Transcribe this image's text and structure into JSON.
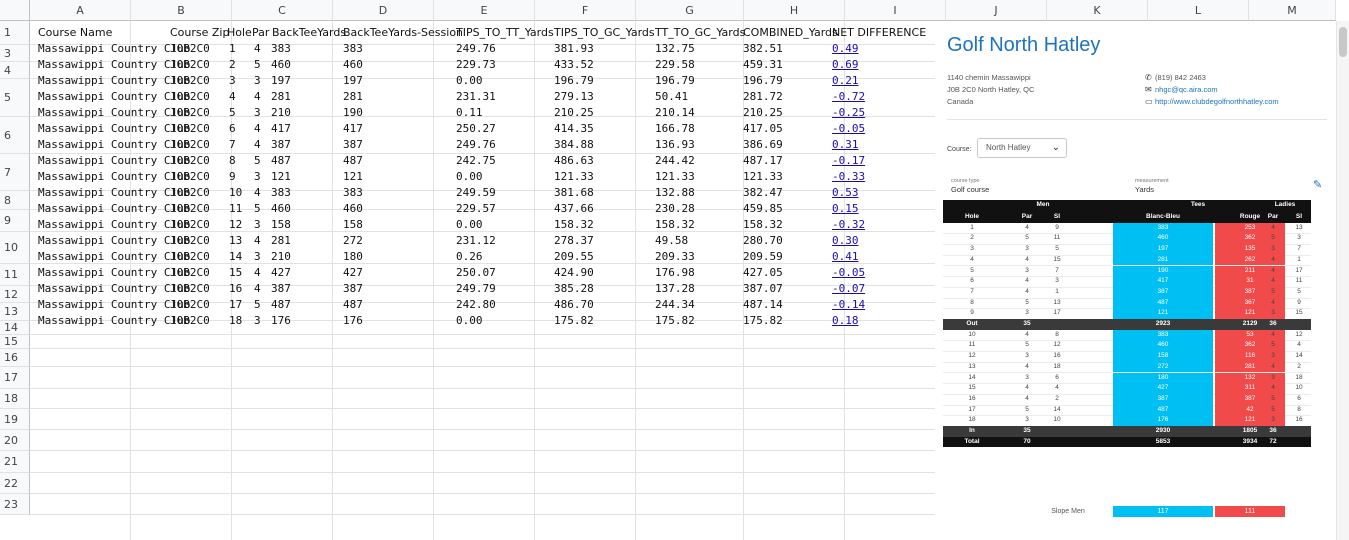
{
  "columns": [
    "A",
    "B",
    "C",
    "D",
    "E",
    "F",
    "G",
    "H",
    "I",
    "J",
    "K",
    "L",
    "M"
  ],
  "row_numbers": [
    "1",
    "3",
    "4",
    "5",
    "6",
    "7",
    "8",
    "9",
    "10",
    "11",
    "12",
    "13",
    "14",
    "15",
    "16",
    "17",
    "18",
    "19",
    "20",
    "21",
    "22",
    "23"
  ],
  "headers": [
    "Course Name",
    "Course Zip",
    "Hole",
    "Par",
    "BackTeeYards",
    "BackTeeYards-Session",
    "TIPS_TO_TT_Yards",
    "TIPS_TO_GC_Yards",
    "TT_TO_GC_Yards",
    "COMBINED_Yards",
    "NET DIFFERENCE"
  ],
  "rows": [
    [
      "Massawippi Country Club",
      "J0B2C0",
      "1",
      "4",
      "383",
      "383",
      "249.76",
      "381.93",
      "132.75",
      "382.51",
      "0.49"
    ],
    [
      "Massawippi Country Club",
      "J0B2C0",
      "2",
      "5",
      "460",
      "460",
      "229.73",
      "433.52",
      "229.58",
      "459.31",
      "0.69"
    ],
    [
      "Massawippi Country Club",
      "J0B2C0",
      "3",
      "3",
      "197",
      "197",
      "0.00",
      "196.79",
      "196.79",
      "196.79",
      "0.21"
    ],
    [
      "Massawippi Country Club",
      "J0B2C0",
      "4",
      "4",
      "281",
      "281",
      "231.31",
      "279.13",
      "50.41",
      "281.72",
      "-0.72"
    ],
    [
      "Massawippi Country Club",
      "J0B2C0",
      "5",
      "3",
      "210",
      "190",
      "0.11",
      "210.25",
      "210.14",
      "210.25",
      "-0.25"
    ],
    [
      "Massawippi Country Club",
      "J0B2C0",
      "6",
      "4",
      "417",
      "417",
      "250.27",
      "414.35",
      "166.78",
      "417.05",
      "-0.05"
    ],
    [
      "Massawippi Country Club",
      "J0B2C0",
      "7",
      "4",
      "387",
      "387",
      "249.76",
      "384.88",
      "136.93",
      "386.69",
      "0.31"
    ],
    [
      "Massawippi Country Club",
      "J0B2C0",
      "8",
      "5",
      "487",
      "487",
      "242.75",
      "486.63",
      "244.42",
      "487.17",
      "-0.17"
    ],
    [
      "Massawippi Country Club",
      "J0B2C0",
      "9",
      "3",
      "121",
      "121",
      "0.00",
      "121.33",
      "121.33",
      "121.33",
      "-0.33"
    ],
    [
      "Massawippi Country Club",
      "J0B2C0",
      "10",
      "4",
      "383",
      "383",
      "249.59",
      "381.68",
      "132.88",
      "382.47",
      "0.53"
    ],
    [
      "Massawippi Country Club",
      "J0B2C0",
      "11",
      "5",
      "460",
      "460",
      "229.57",
      "437.66",
      "230.28",
      "459.85",
      "0.15"
    ],
    [
      "Massawippi Country Club",
      "J0B2C0",
      "12",
      "3",
      "158",
      "158",
      "0.00",
      "158.32",
      "158.32",
      "158.32",
      "-0.32"
    ],
    [
      "Massawippi Country Club",
      "J0B2C0",
      "13",
      "4",
      "281",
      "272",
      "231.12",
      "278.37",
      "49.58",
      "280.70",
      "0.30"
    ],
    [
      "Massawippi Country Club",
      "J0B2C0",
      "14",
      "3",
      "210",
      "180",
      "0.26",
      "209.55",
      "209.33",
      "209.59",
      "0.41"
    ],
    [
      "Massawippi Country Club",
      "J0B2C0",
      "15",
      "4",
      "427",
      "427",
      "250.07",
      "424.90",
      "176.98",
      "427.05",
      "-0.05"
    ],
    [
      "Massawippi Country Club",
      "J0B2C0",
      "16",
      "4",
      "387",
      "387",
      "249.79",
      "385.28",
      "137.28",
      "387.07",
      "-0.07"
    ],
    [
      "Massawippi Country Club",
      "J0B2C0",
      "17",
      "5",
      "487",
      "487",
      "242.80",
      "486.70",
      "244.34",
      "487.14",
      "-0.14"
    ],
    [
      "Massawippi Country Club",
      "J0B2C0",
      "18",
      "3",
      "176",
      "176",
      "0.00",
      "175.82",
      "175.82",
      "175.82",
      "0.18"
    ]
  ],
  "panel": {
    "title": "Golf North Hatley",
    "address": [
      "1140 chemin Massawippi",
      "J0B 2C0 North Hatley, QC",
      "Canada"
    ],
    "phone": "(819) 842 2463",
    "email": "nhgc@qc.aira.com",
    "website": "http://www.clubdegolfnorthhatley.com",
    "course_label": "Course:",
    "course_value": "North Hatley",
    "course_type_label": "course type",
    "course_type": "Golf course",
    "measurement_label": "measurement",
    "measurement": "Yards",
    "group_headers": {
      "men": "Men",
      "tees": "Tees",
      "ladies": "Ladies"
    },
    "col_headers": [
      "Hole",
      "Par",
      "SI",
      "Blanc-Bleu",
      "Rouge",
      "Par",
      "SI"
    ],
    "front": [
      [
        "1",
        "4",
        "9",
        "383",
        "253",
        "4",
        "13"
      ],
      [
        "2",
        "5",
        "11",
        "460",
        "362",
        "5",
        "3"
      ],
      [
        "3",
        "3",
        "5",
        "197",
        "135",
        "3",
        "7"
      ],
      [
        "4",
        "4",
        "15",
        "281",
        "262",
        "4",
        "1"
      ],
      [
        "5",
        "3",
        "7",
        "190",
        "211",
        "4",
        "17"
      ],
      [
        "6",
        "4",
        "3",
        "417",
        "31",
        "4",
        "11"
      ],
      [
        "7",
        "4",
        "1",
        "387",
        "387",
        "5",
        "5"
      ],
      [
        "8",
        "5",
        "13",
        "487",
        "367",
        "4",
        "9"
      ],
      [
        "9",
        "3",
        "17",
        "121",
        "121",
        "3",
        "15"
      ]
    ],
    "out": [
      "Out",
      "35",
      "",
      "2923",
      "2129",
      "36",
      ""
    ],
    "back": [
      [
        "10",
        "4",
        "8",
        "383",
        "53",
        "4",
        "12"
      ],
      [
        "11",
        "5",
        "12",
        "460",
        "362",
        "5",
        "4"
      ],
      [
        "12",
        "3",
        "16",
        "158",
        "116",
        "3",
        "14"
      ],
      [
        "13",
        "4",
        "18",
        "272",
        "281",
        "4",
        "2"
      ],
      [
        "14",
        "3",
        "6",
        "180",
        "132",
        "3",
        "18"
      ],
      [
        "15",
        "4",
        "4",
        "427",
        "311",
        "4",
        "10"
      ],
      [
        "16",
        "4",
        "2",
        "387",
        "387",
        "5",
        "6"
      ],
      [
        "17",
        "5",
        "14",
        "487",
        "42",
        "5",
        "8"
      ],
      [
        "18",
        "3",
        "10",
        "176",
        "121",
        "3",
        "16"
      ]
    ],
    "in": [
      "In",
      "35",
      "",
      "2930",
      "1805",
      "36",
      ""
    ],
    "total": [
      "Total",
      "70",
      "",
      "5853",
      "3934",
      "72",
      ""
    ],
    "slope_label": "Slope Men",
    "slope_blue": "117",
    "slope_red": "111",
    "colors": {
      "blue": "#00bff3",
      "red": "#f04a4a",
      "title": "#1e73be"
    }
  }
}
